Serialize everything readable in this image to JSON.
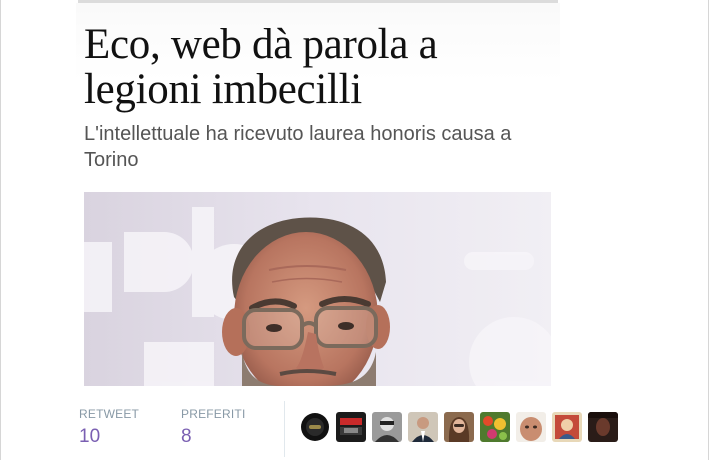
{
  "article": {
    "headline": "Eco, web dà parola a legioni imbecilli",
    "subheadline": "L'intellettuale ha ricevuto laurea honoris causa a Torino",
    "photo_icon": "portrait-photo"
  },
  "stats": {
    "retweet_label": "RETWEET",
    "retweet_count": "10",
    "favorites_label": "PREFERITI",
    "favorites_count": "8"
  },
  "avatars": [
    {
      "icon": "avatar-dark-logo"
    },
    {
      "icon": "avatar-red-logo"
    },
    {
      "icon": "avatar-bw-portrait"
    },
    {
      "icon": "avatar-suit-portrait"
    },
    {
      "icon": "avatar-woman-portrait"
    },
    {
      "icon": "avatar-flowers"
    },
    {
      "icon": "avatar-face-closeup"
    },
    {
      "icon": "avatar-painting"
    },
    {
      "icon": "avatar-dark-portrait"
    }
  ],
  "colors": {
    "count_color": "#7a5fb2",
    "label_color": "#8899a6",
    "divider": "#e1e8ed"
  }
}
